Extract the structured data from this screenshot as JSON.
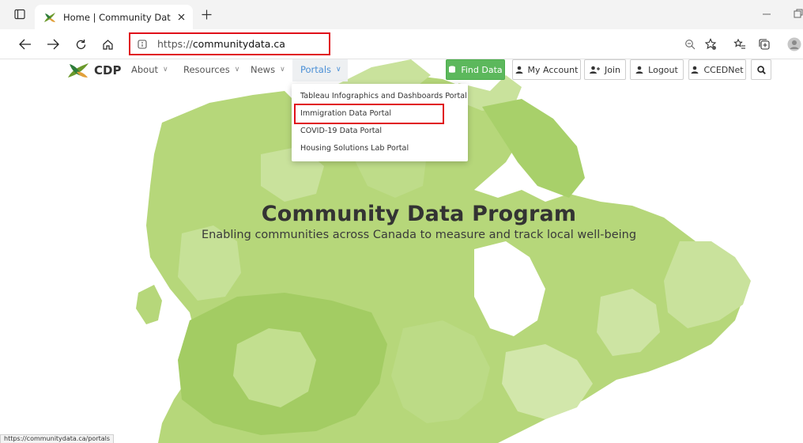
{
  "browser": {
    "tab": {
      "title": "Home | Community Data Program",
      "favicon": "cdp-leaf-icon"
    },
    "address": {
      "scheme": "https://",
      "host": "communitydata.ca"
    },
    "status_url": "https://communitydata.ca/portals"
  },
  "site": {
    "logo_text": "CDP",
    "menu": [
      {
        "label": "About"
      },
      {
        "label": "Resources"
      },
      {
        "label": "News"
      },
      {
        "label": "Portals",
        "active": true
      }
    ],
    "buttons": {
      "find_data": "Find Data",
      "my_account": "My Account",
      "join": "Join",
      "logout": "Logout",
      "ccednet": "CCEDNet"
    },
    "portals_dropdown": [
      "Tableau Infographics and Dashboards Portal",
      "Immigration Data Portal",
      "COVID-19 Data Portal",
      "Housing Solutions Lab Portal"
    ],
    "hero": {
      "title": "Community Data Program",
      "subtitle": "Enabling communities across Canada to measure and track local well-being"
    }
  },
  "colors": {
    "find_data_green": "#5cb85c",
    "highlight_red": "#e0101a",
    "portals_active_blue": "#4a8fd6",
    "map_green": "#b6d77a"
  }
}
